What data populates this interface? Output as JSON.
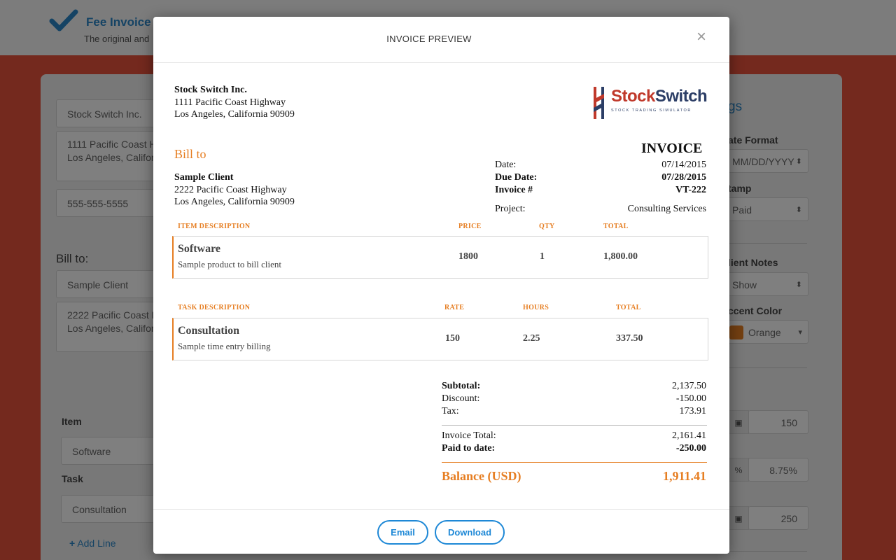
{
  "background": {
    "app_title": "Fee Invoice M",
    "app_subtitle": "The original and",
    "company_field": "Stock Switch Inc.",
    "company_address_field": "1111 Pacific Coast Hi\nLos Angeles, Californ",
    "phone_field": "555-555-5555",
    "bill_to_label": "Bill to:",
    "client_field": "Sample Client",
    "client_address_field": "2222 Pacific Coast Hi\nLos Angeles, Californ",
    "item_label": "Item",
    "item_field": "Software",
    "task_label": "Task",
    "task_field": "Consultation",
    "add_line_label": "Add Line",
    "settings_title_fragment": "gs",
    "date_format_label": "ate Format",
    "date_format_value": "MM/DD/YYYY",
    "stamp_label": "tamp",
    "stamp_value": "Paid",
    "client_notes_label": "lient Notes",
    "client_notes_value": "Show",
    "accent_color_label": "ccent Color",
    "accent_color_value": "Orange",
    "accent_color_hex": "#e67e22",
    "discount_value": "150",
    "tax_rate_value": "8.75%",
    "paid_value": "250",
    "percent_symbol": "%"
  },
  "modal": {
    "title": "INVOICE PREVIEW",
    "close_glyph": "×",
    "email_button": "Email",
    "download_button": "Download"
  },
  "invoice": {
    "sender": {
      "name": "Stock Switch Inc.",
      "address_line1": "1111 Pacific Coast Highway",
      "address_line2": "Los Angeles, California 90909"
    },
    "logo": {
      "word_part1": "Stock",
      "word_part2": "Switch",
      "tagline": "STOCK TRADING SIMULATOR",
      "colors": {
        "red": "#c0392b",
        "navy": "#2c3e66"
      }
    },
    "bill_to_heading": "Bill to",
    "client": {
      "name": "Sample Client",
      "address_line1": "2222 Pacific Coast Highway",
      "address_line2": "Los Angeles, California 90909"
    },
    "heading": "INVOICE",
    "meta": {
      "date_label": "Date:",
      "date_value": "07/14/2015",
      "due_label": "Due Date:",
      "due_value": "07/28/2015",
      "number_label": "Invoice #",
      "number_value": "VT-222",
      "project_label": "Project:",
      "project_value": "Consulting Services"
    },
    "items_table": {
      "headers": [
        "ITEM DESCRIPTION",
        "PRICE",
        "QTY",
        "TOTAL"
      ],
      "rows": [
        {
          "title": "Software",
          "description": "Sample product to bill client",
          "price": "1800",
          "qty": "1",
          "total": "1,800.00"
        }
      ]
    },
    "tasks_table": {
      "headers": [
        "TASK DESCRIPTION",
        "RATE",
        "HOURS",
        "TOTAL"
      ],
      "rows": [
        {
          "title": "Consultation",
          "description": "Sample time entry billing",
          "rate": "150",
          "hours": "2.25",
          "total": "337.50"
        }
      ]
    },
    "totals": {
      "subtotal_label": "Subtotal:",
      "subtotal_value": "2,137.50",
      "discount_label": "Discount:",
      "discount_value": "-150.00",
      "tax_label": "Tax:",
      "tax_value": "173.91",
      "invoice_total_label": "Invoice Total:",
      "invoice_total_value": "2,161.41",
      "paid_label": "Paid to date:",
      "paid_value": "-250.00",
      "balance_label": "Balance (USD)",
      "balance_value": "1,911.41"
    },
    "accent_color": "#e67e22"
  }
}
